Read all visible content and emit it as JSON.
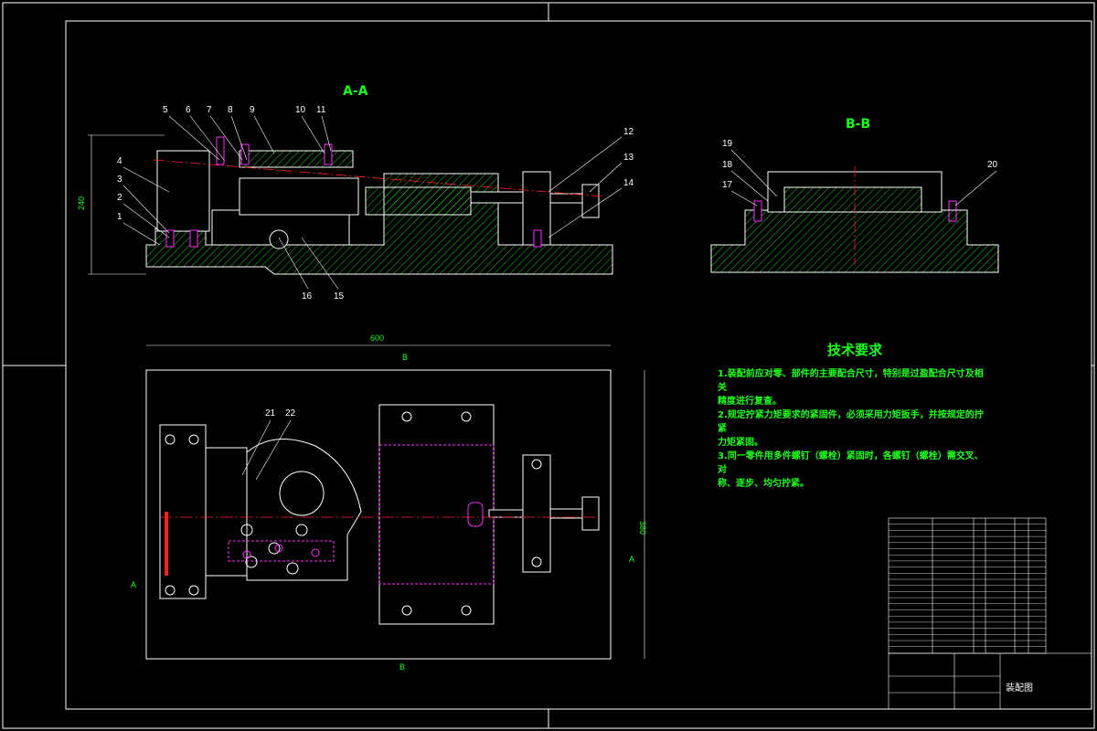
{
  "views": {
    "section_aa": "A-A",
    "section_bb": "B-B"
  },
  "part_labels_aa_top": [
    "5",
    "6",
    "7",
    "8",
    "9",
    "10",
    "11"
  ],
  "part_labels_aa_left": [
    "4",
    "3",
    "2",
    "1"
  ],
  "part_labels_aa_right": [
    "12",
    "13",
    "14"
  ],
  "part_labels_aa_bottom": [
    "16",
    "15"
  ],
  "part_labels_bb": [
    "19",
    "18",
    "17",
    "20"
  ],
  "part_labels_plan": [
    "21",
    "22"
  ],
  "dimensions": {
    "height_aa": "240",
    "plan_width": "600",
    "plan_height": "380"
  },
  "section_markers": {
    "a": "A",
    "b": "B"
  },
  "technical_requirements": {
    "title": "技术要求",
    "items": [
      "1.装配前应对零、部件的主要配合尺寸，特别是过盈配合尺寸及相关",
      "精度进行复查。",
      "2.规定拧紧力矩要求的紧固件，必须采用力矩扳手，并按规定的拧紧",
      "力矩紧固。",
      "3.同一零件用多件螺钉（螺栓）紧固时，各螺钉（螺栓）需交叉、对",
      "称、逐步、均匀拧紧。"
    ]
  },
  "title_block": {
    "drawing_name": "装配图"
  },
  "colors": {
    "background": "#000000",
    "frame": "#ffffff",
    "text_green": "#1cff1c",
    "hatch_green": "#1cff1c",
    "part_outline": "#ffffff",
    "center_line": "#ff2020",
    "highlight": "#ff2dff",
    "leader": "#ffffff"
  }
}
